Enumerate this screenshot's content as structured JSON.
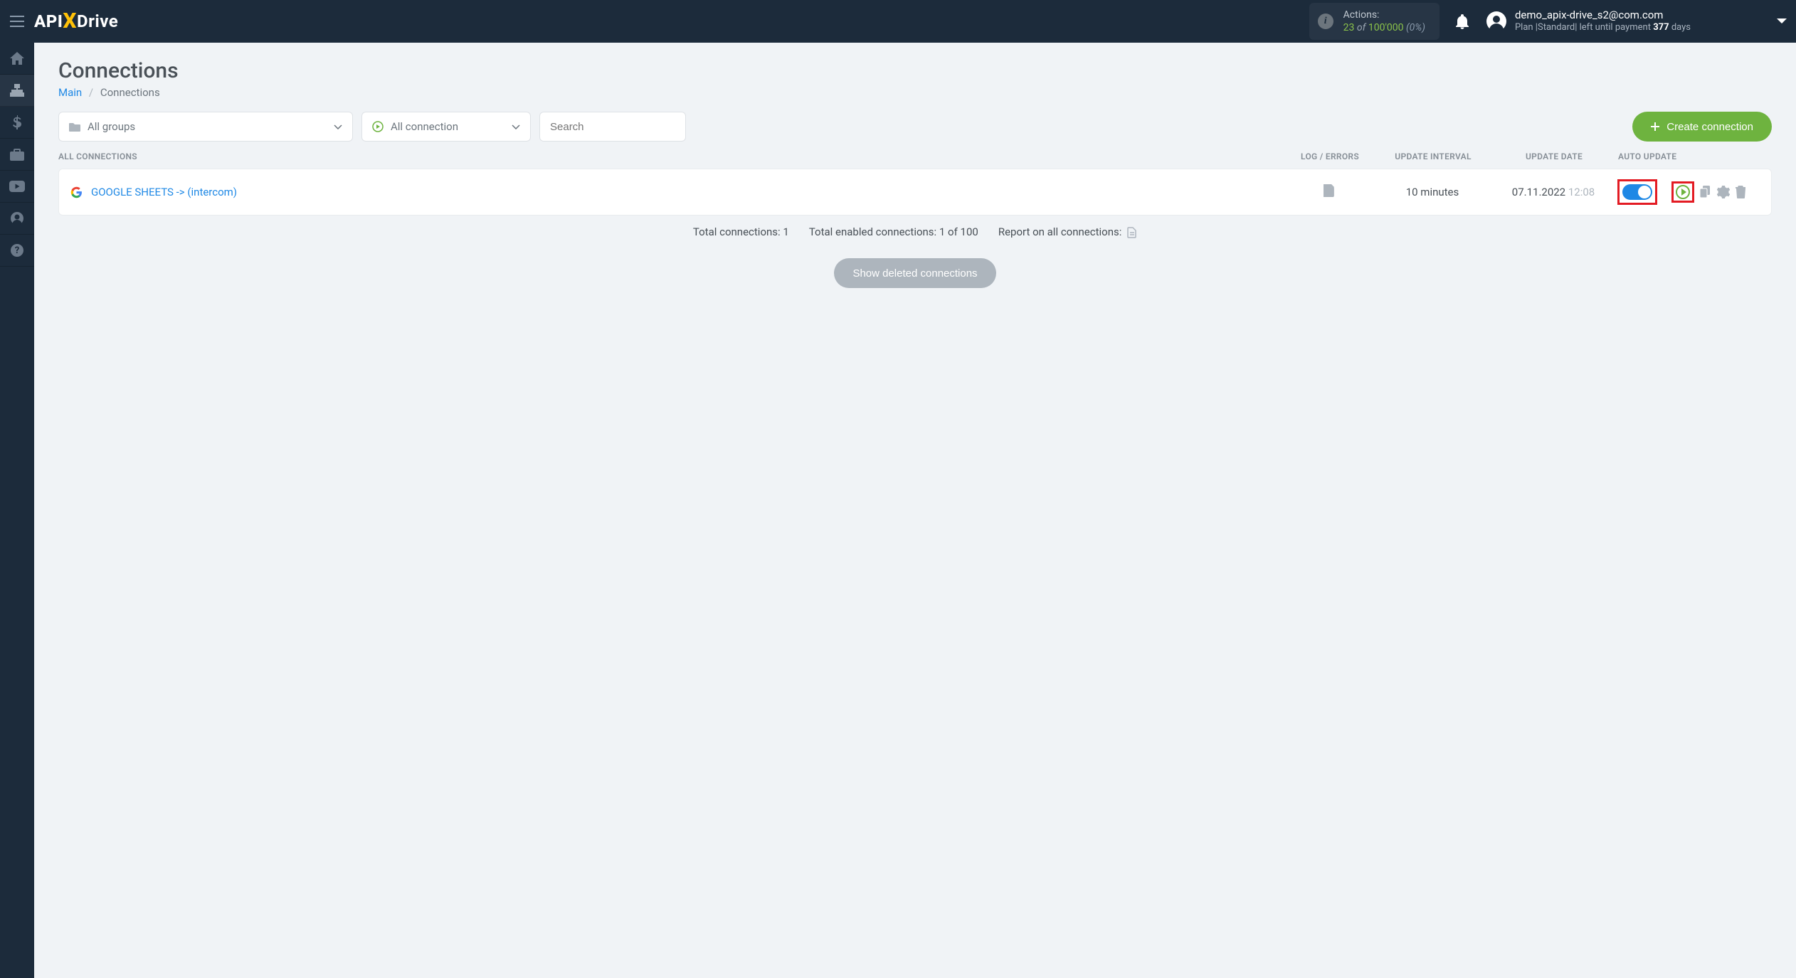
{
  "header": {
    "actions_label": "Actions:",
    "actions_count": "23",
    "actions_of": "of",
    "actions_total": "100'000",
    "actions_pct": "(0%)",
    "user_email": "demo_apix-drive_s2@com.com",
    "plan_prefix": "Plan |",
    "plan_name": "Standard",
    "plan_mid": "| left until payment",
    "plan_days": "377",
    "plan_days_suffix": "days"
  },
  "page": {
    "title": "Connections"
  },
  "breadcrumb": {
    "main": "Main",
    "current": "Connections"
  },
  "filters": {
    "groups": "All groups",
    "connection": "All connection",
    "search_placeholder": "Search"
  },
  "buttons": {
    "create_connection": "Create connection",
    "show_deleted": "Show deleted connections"
  },
  "table": {
    "header_all": "ALL CONNECTIONS",
    "header_log": "LOG / ERRORS",
    "header_interval": "UPDATE INTERVAL",
    "header_date": "UPDATE DATE",
    "header_auto": "AUTO UPDATE",
    "rows": [
      {
        "name": "GOOGLE SHEETS -> (intercom)",
        "interval": "10 minutes",
        "date": "07.11.2022",
        "time": "12:08",
        "auto_update": true
      }
    ]
  },
  "summary": {
    "total": "Total connections: 1",
    "enabled": "Total enabled connections: 1 of 100",
    "report": "Report on all connections:"
  }
}
